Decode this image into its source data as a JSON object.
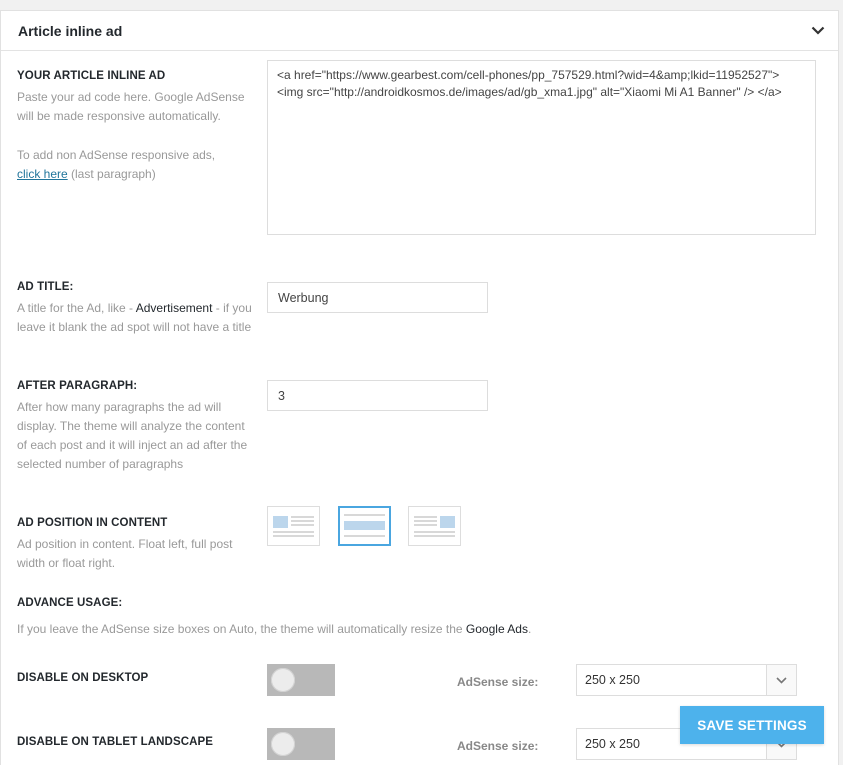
{
  "panel": {
    "title": "Article inline ad",
    "collapse_icon": "chevron-down-icon"
  },
  "ad_code": {
    "label": "YOUR ARTICLE INLINE AD",
    "desc1": "Paste your ad code here. Google AdSense will be made responsive automatically.",
    "desc2_prefix": "To add non AdSense responsive ads,",
    "link_text": "click here",
    "desc2_suffix": " (last paragraph)",
    "value": "<a href=\"https://www.gearbest.com/cell-phones/pp_757529.html?wid=4&amp;lkid=11952527\">\n<img src=\"http://androidkosmos.de/images/ad/gb_xma1.jpg\" alt=\"Xiaomi Mi A1 Banner\" /> </a>"
  },
  "ad_title": {
    "label": "AD TITLE:",
    "desc_prefix": "A title for the Ad, like - ",
    "desc_bold": "Advertisement",
    "desc_suffix": " - if you leave it blank the ad spot will not have a title",
    "value": "Werbung"
  },
  "after_paragraph": {
    "label": "AFTER PARAGRAPH:",
    "desc": "After how many paragraphs the ad will display. The theme will analyze the content of each post and it will inject an ad after the selected number of paragraphs",
    "value": "3"
  },
  "ad_position": {
    "label": "AD POSITION IN CONTENT",
    "desc": "Ad position in content. Float left, full post width or float right.",
    "options": [
      "float-left",
      "full-width",
      "float-right"
    ],
    "selected": "full-width"
  },
  "advance_usage": {
    "label": "ADVANCE USAGE:",
    "desc_prefix": "If you leave the AdSense size boxes on Auto, the theme will automatically resize the ",
    "desc_bold": "Google Ads",
    "desc_suffix": "."
  },
  "devices": [
    {
      "label": "DISABLE ON DESKTOP",
      "adsense_label": "AdSense size:",
      "size": "250 x 250",
      "disabled": false
    },
    {
      "label": "DISABLE ON TABLET LANDSCAPE",
      "adsense_label": "AdSense size:",
      "size": "250 x 250",
      "disabled": false
    }
  ],
  "save_label": "SAVE SETTINGS",
  "colors": {
    "accent": "#4db2ec",
    "toggle_off": "#b8b8b8",
    "link": "#21759b"
  }
}
